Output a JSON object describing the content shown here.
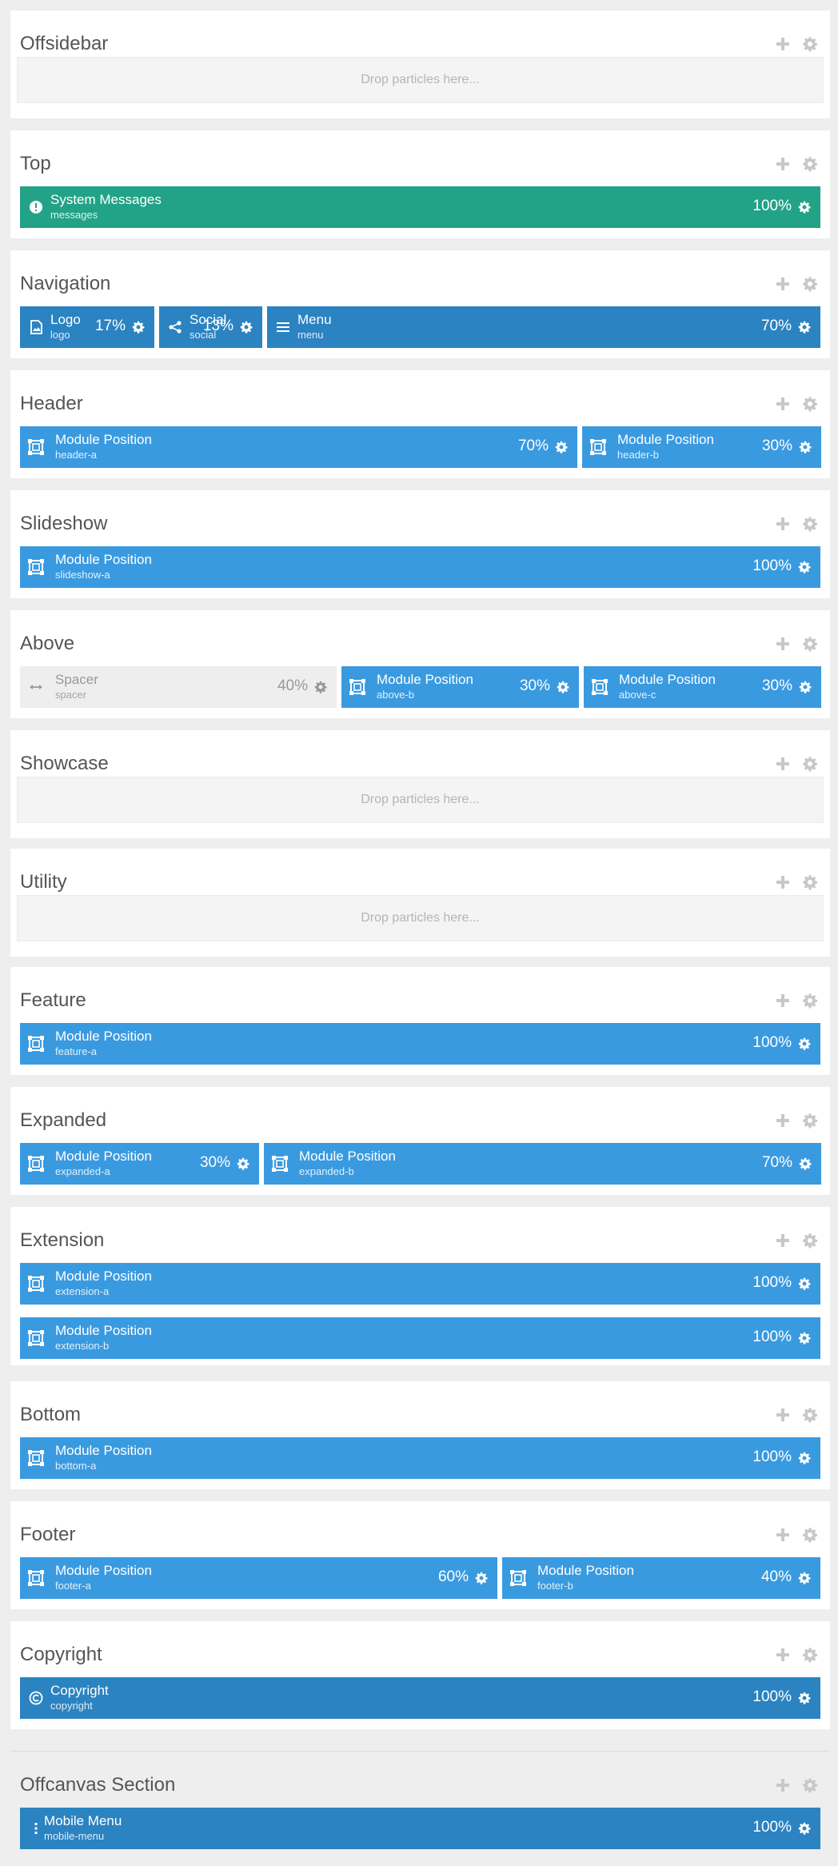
{
  "dropzone_text": "Drop particles here...",
  "colors": {
    "page_bg": "#eeeeee",
    "section_bg": "#ffffff",
    "position_blue": "#3a9ae0",
    "particle_dark_blue": "#2b83c1",
    "system_green": "#22a286",
    "spacer_gray": "#eeeeee"
  },
  "sections": [
    {
      "title": "Offsidebar",
      "rows": []
    },
    {
      "title": "Top",
      "rows": [
        [
          {
            "name": "System Messages",
            "key": "messages",
            "size": "100%",
            "icon": "alert-icon",
            "variant": "green"
          }
        ]
      ]
    },
    {
      "title": "Navigation",
      "rows": [
        [
          {
            "name": "Logo",
            "key": "logo",
            "size": "17%",
            "icon": "image-icon",
            "variant": "dark"
          },
          {
            "name": "Social",
            "key": "social",
            "size": "13%",
            "icon": "share-icon",
            "variant": "dark"
          },
          {
            "name": "Menu",
            "key": "menu",
            "size": "70%",
            "icon": "menu-lines-icon",
            "variant": "dark"
          }
        ]
      ]
    },
    {
      "title": "Header",
      "rows": [
        [
          {
            "name": "Module Position",
            "key": "header-a",
            "size": "70%",
            "icon": "module-icon",
            "variant": "blue"
          },
          {
            "name": "Module Position",
            "key": "header-b",
            "size": "30%",
            "icon": "module-icon",
            "variant": "blue"
          }
        ]
      ]
    },
    {
      "title": "Slideshow",
      "rows": [
        [
          {
            "name": "Module Position",
            "key": "slideshow-a",
            "size": "100%",
            "icon": "module-icon",
            "variant": "blue"
          }
        ]
      ]
    },
    {
      "title": "Above",
      "rows": [
        [
          {
            "name": "Spacer",
            "key": "spacer",
            "size": "40%",
            "icon": "resize-horizontal-icon",
            "variant": "spacer"
          },
          {
            "name": "Module Position",
            "key": "above-b",
            "size": "30%",
            "icon": "module-icon",
            "variant": "blue"
          },
          {
            "name": "Module Position",
            "key": "above-c",
            "size": "30%",
            "icon": "module-icon",
            "variant": "blue"
          }
        ]
      ]
    },
    {
      "title": "Showcase",
      "rows": []
    },
    {
      "title": "Utility",
      "rows": []
    },
    {
      "title": "Feature",
      "rows": [
        [
          {
            "name": "Module Position",
            "key": "feature-a",
            "size": "100%",
            "icon": "module-icon",
            "variant": "blue"
          }
        ]
      ]
    },
    {
      "title": "Expanded",
      "rows": [
        [
          {
            "name": "Module Position",
            "key": "expanded-a",
            "size": "30%",
            "icon": "module-icon",
            "variant": "blue"
          },
          {
            "name": "Module Position",
            "key": "expanded-b",
            "size": "70%",
            "icon": "module-icon",
            "variant": "blue"
          }
        ]
      ]
    },
    {
      "title": "Extension",
      "rows": [
        [
          {
            "name": "Module Position",
            "key": "extension-a",
            "size": "100%",
            "icon": "module-icon",
            "variant": "blue"
          }
        ],
        [
          {
            "name": "Module Position",
            "key": "extension-b",
            "size": "100%",
            "icon": "module-icon",
            "variant": "blue"
          }
        ]
      ]
    },
    {
      "title": "Bottom",
      "rows": [
        [
          {
            "name": "Module Position",
            "key": "bottom-a",
            "size": "100%",
            "icon": "module-icon",
            "variant": "blue"
          }
        ]
      ]
    },
    {
      "title": "Footer",
      "rows": [
        [
          {
            "name": "Module Position",
            "key": "footer-a",
            "size": "60%",
            "icon": "module-icon",
            "variant": "blue"
          },
          {
            "name": "Module Position",
            "key": "footer-b",
            "size": "40%",
            "icon": "module-icon",
            "variant": "blue"
          }
        ]
      ]
    },
    {
      "title": "Copyright",
      "rows": [
        [
          {
            "name": "Copyright",
            "key": "copyright",
            "size": "100%",
            "icon": "copyright-icon",
            "variant": "dark"
          }
        ]
      ]
    },
    {
      "title": "Offcanvas Section",
      "offcanvas": true,
      "rows": [
        [
          {
            "name": "Mobile Menu",
            "key": "mobile-menu",
            "size": "100%",
            "icon": "vertical-dots-icon",
            "variant": "dark"
          }
        ]
      ]
    }
  ]
}
